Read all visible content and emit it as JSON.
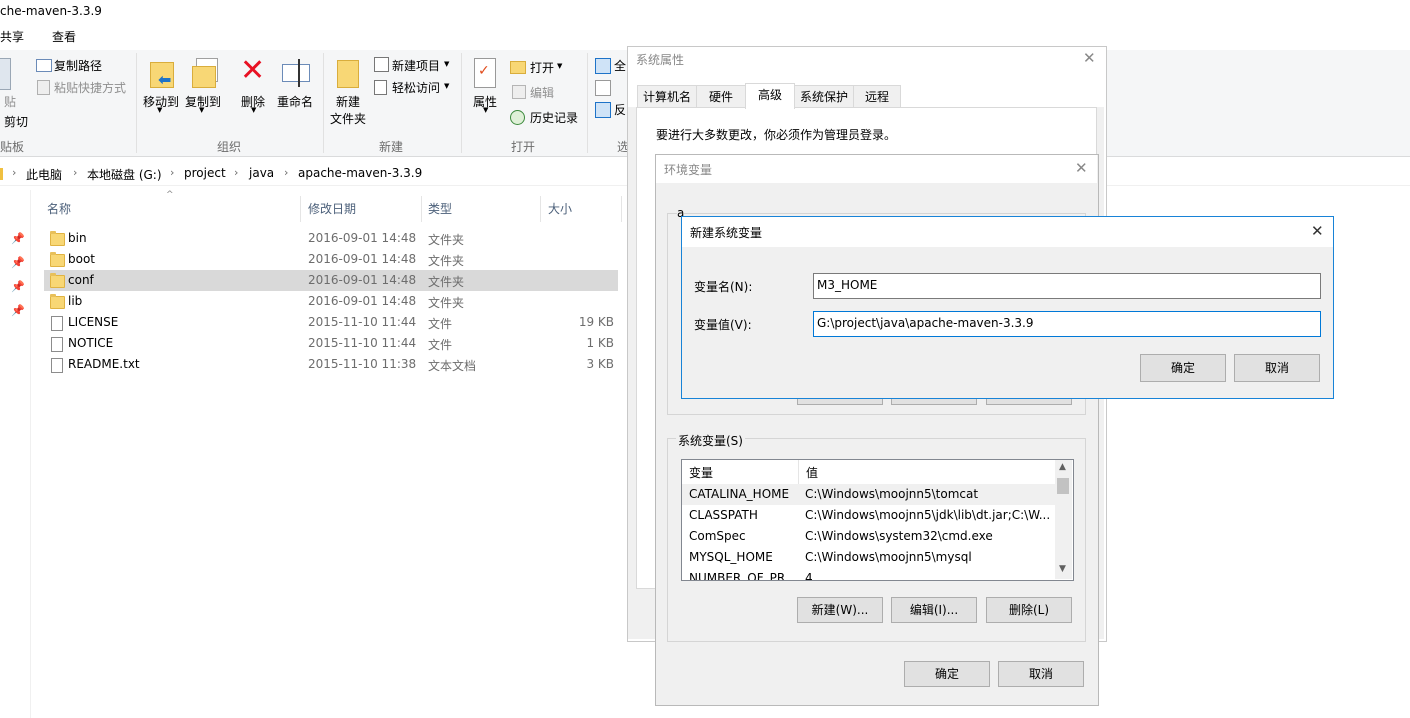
{
  "window": {
    "title": "che-maven-3.3.9"
  },
  "menu": {
    "share": "共享",
    "view": "查看"
  },
  "ribbon": {
    "paste_partial": "贴",
    "cut": "剪切",
    "clipboard_group": "贴板",
    "copy_path": "复制路径",
    "paste_shortcut": "粘贴快捷方式",
    "move_to": "移动到",
    "copy_to": "复制到",
    "delete": "删除",
    "rename": "重命名",
    "organize_group": "组织",
    "new_folder_l1": "新建",
    "new_folder_l2": "文件夹",
    "new_item": "新建项目",
    "easy_access": "轻松访问",
    "new_group": "新建",
    "properties": "属性",
    "open": "打开",
    "edit": "编辑",
    "history": "历史记录",
    "open_group": "打开",
    "select_all_partial": "全",
    "invert_partial": "反",
    "select_group_partial": "选"
  },
  "breadcrumb": [
    "此电脑",
    "本地磁盘 (G:)",
    "project",
    "java",
    "apache-maven-3.3.9"
  ],
  "file_list": {
    "headers": {
      "name": "名称",
      "date": "修改日期",
      "type": "类型",
      "size": "大小"
    },
    "rows": [
      {
        "name": "bin",
        "date": "2016-09-01 14:48",
        "type": "文件夹",
        "size": "",
        "kind": "folder"
      },
      {
        "name": "boot",
        "date": "2016-09-01 14:48",
        "type": "文件夹",
        "size": "",
        "kind": "folder"
      },
      {
        "name": "conf",
        "date": "2016-09-01 14:48",
        "type": "文件夹",
        "size": "",
        "kind": "folder"
      },
      {
        "name": "lib",
        "date": "2016-09-01 14:48",
        "type": "文件夹",
        "size": "",
        "kind": "folder"
      },
      {
        "name": "LICENSE",
        "date": "2015-11-10 11:44",
        "type": "文件",
        "size": "19 KB",
        "kind": "file"
      },
      {
        "name": "NOTICE",
        "date": "2015-11-10 11:44",
        "type": "文件",
        "size": "1 KB",
        "kind": "file"
      },
      {
        "name": "README.txt",
        "date": "2015-11-10 11:38",
        "type": "文本文档",
        "size": "3 KB",
        "kind": "file"
      }
    ]
  },
  "sys_props": {
    "title": "系统属性",
    "tabs": [
      "计算机名",
      "硬件",
      "高级",
      "系统保护",
      "远程"
    ],
    "admin_note": "要进行大多数更改，你必须作为管理员登录。"
  },
  "env_vars": {
    "title": "环境变量",
    "user_vars_partial": "a",
    "sys_vars_label": "系统变量(S)",
    "columns": {
      "var": "变量",
      "value": "值"
    },
    "rows": [
      {
        "var": "CATALINA_HOME",
        "value": "C:\\Windows\\moojnn5\\tomcat"
      },
      {
        "var": "CLASSPATH",
        "value": "C:\\Windows\\moojnn5\\jdk\\lib\\dt.jar;C:\\W..."
      },
      {
        "var": "ComSpec",
        "value": "C:\\Windows\\system32\\cmd.exe"
      },
      {
        "var": "MYSQL_HOME",
        "value": "C:\\Windows\\moojnn5\\mysql"
      },
      {
        "var": "NUMBER_OF_PR...",
        "value": "4"
      }
    ],
    "new_btn": "新建(W)...",
    "edit_btn": "编辑(I)...",
    "delete_btn": "删除(L)",
    "ok": "确定",
    "cancel": "取消"
  },
  "new_var": {
    "title": "新建系统变量",
    "name_label": "变量名(N):",
    "name_value": "M3_HOME",
    "value_label": "变量值(V):",
    "value_value": "G:\\project\\java\\apache-maven-3.3.9",
    "ok": "确定",
    "cancel": "取消"
  }
}
